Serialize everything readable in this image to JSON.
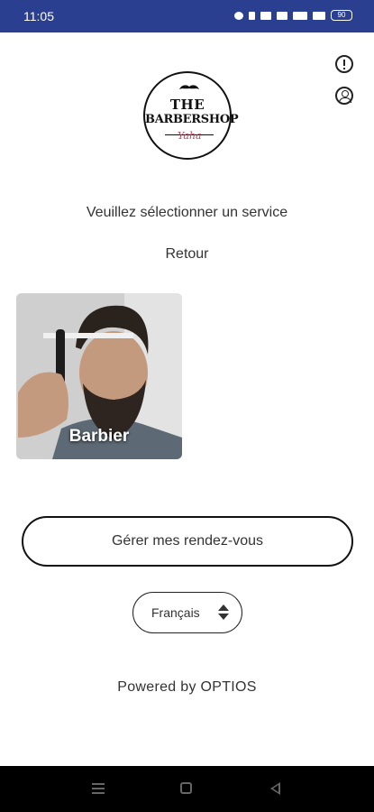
{
  "status_bar": {
    "time": "11:05",
    "battery": "90"
  },
  "header": {
    "logo": {
      "line1": "THE",
      "line2": "BARBERSHOP",
      "script": "Yaha"
    }
  },
  "main": {
    "instruction": "Veuillez sélectionner un service",
    "back_label": "Retour",
    "services": [
      {
        "label": "Barbier"
      }
    ],
    "manage_button_label": "Gérer mes rendez-vous",
    "language": {
      "selected": "Français"
    },
    "footer": "Powered by OPTIOS"
  },
  "colors": {
    "status_bar": "#2a3f8f",
    "logo_script": "#c0425a",
    "nav_bar": "#000000"
  },
  "icons": {
    "info": "info-icon",
    "account": "account-icon",
    "language_toggle": "updown-icon"
  }
}
